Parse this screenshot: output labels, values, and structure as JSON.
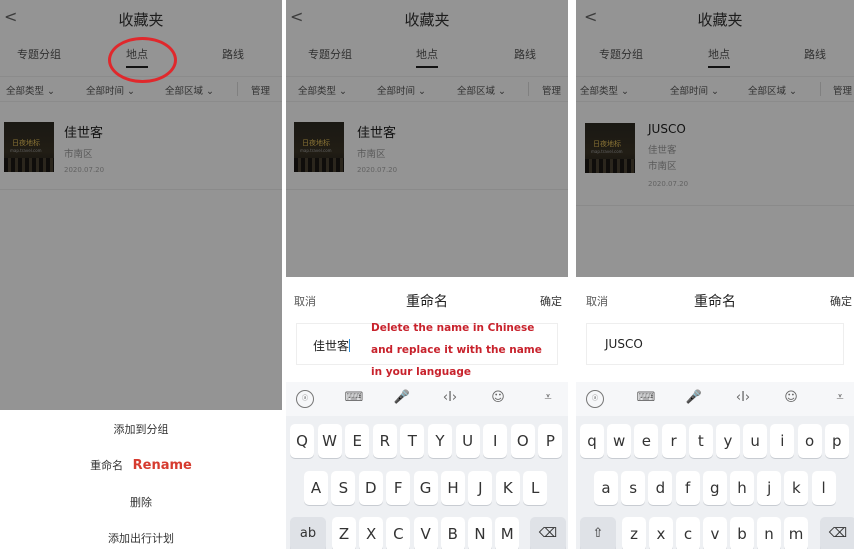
{
  "header": {
    "back": "<",
    "title": "收藏夹"
  },
  "tabs": [
    "专题分组",
    "地点",
    "路线"
  ],
  "filters": {
    "type": "全部类型 ⌄",
    "time": "全部时间 ⌄",
    "area": "全部区域 ⌄",
    "manage": "管理"
  },
  "thumb": {
    "logo": "日夜地标",
    "sub": "map.travel.com"
  },
  "item": {
    "name_cn": "佳世客",
    "name_en": "JUSCO",
    "district": "市南区",
    "sub_cn": "佳世客",
    "date": "2020.07.20"
  },
  "sheet": {
    "add_group": "添加到分组",
    "rename": "重命名",
    "rename_annot": "Rename",
    "delete": "删除",
    "add_plan": "添加出行计划"
  },
  "dialog": {
    "cancel": "取消",
    "title": "重命名",
    "confirm": "确定",
    "value_cn": "佳世客",
    "value_en": "JUSCO",
    "annotation": [
      "Delete the name in Chinese",
      "and replace it with the name",
      "in your language"
    ]
  },
  "keyboard": {
    "tools": [
      "ⓐ",
      "⌨",
      "🎤",
      "‹I›",
      "☺",
      "⩡"
    ],
    "upper_row1": [
      "Q",
      "W",
      "E",
      "R",
      "T",
      "Y",
      "U",
      "I",
      "O",
      "P"
    ],
    "upper_row2": [
      "A",
      "S",
      "D",
      "F",
      "G",
      "H",
      "J",
      "K",
      "L"
    ],
    "upper_row3": [
      "Z",
      "X",
      "C",
      "V",
      "B",
      "N",
      "M"
    ],
    "lower_row1": [
      "q",
      "w",
      "e",
      "r",
      "t",
      "y",
      "u",
      "i",
      "o",
      "p"
    ],
    "lower_row2": [
      "a",
      "s",
      "d",
      "f",
      "g",
      "h",
      "j",
      "k",
      "l"
    ],
    "lower_row3": [
      "z",
      "x",
      "c",
      "v",
      "b",
      "n",
      "m"
    ],
    "abc_key": "ab",
    "shift_key": "⇧",
    "backspace_key": "⌫"
  },
  "colors": {
    "annotation_red": "#d63b2f",
    "circle_red": "#e0282c"
  }
}
